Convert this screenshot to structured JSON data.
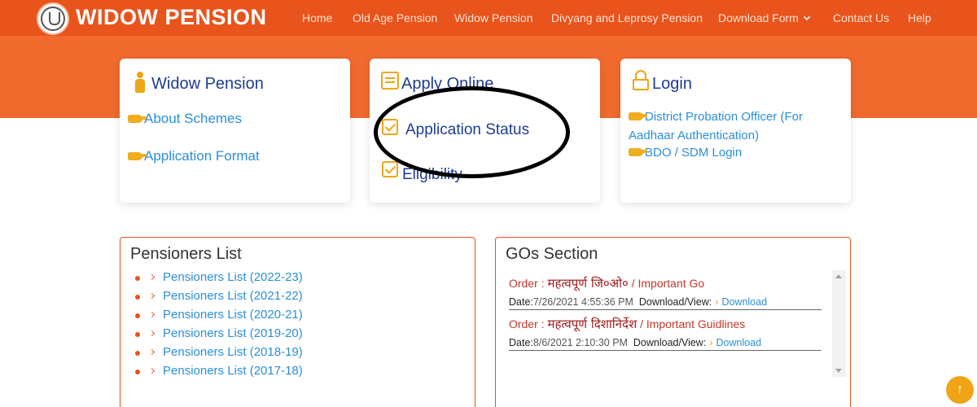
{
  "header": {
    "brand": "WIDOW PENSION",
    "nav": [
      {
        "label": "Home"
      },
      {
        "label": "Old Age Pension"
      },
      {
        "label": "Widow Pension"
      },
      {
        "label": "Divyang and Leprosy Pension"
      },
      {
        "label": "Download Form"
      },
      {
        "label": "Contact Us"
      },
      {
        "label": "Help"
      }
    ]
  },
  "cards": {
    "widow": {
      "title": "Widow Pension",
      "links": [
        "About Schemes",
        "Application Format"
      ]
    },
    "apply": {
      "title": "Apply Online",
      "links": [
        "Application Status",
        "Eligibility"
      ]
    },
    "login": {
      "title": "Login",
      "links": [
        "District Probation Officer (For",
        "Aadhaar Authentication)",
        "BDO / SDM Login"
      ]
    }
  },
  "pensioners": {
    "title": "Pensioners List",
    "items": [
      "Pensioners List (2022-23)",
      "Pensioners List (2021-22)",
      "Pensioners List (2020-21)",
      "Pensioners List (2019-20)",
      "Pensioners List (2018-19)",
      "Pensioners List (2017-18)"
    ]
  },
  "gos": {
    "title": "GOs Section",
    "entries": [
      {
        "order_label": "Order :",
        "hindi": "महत्वपूर्ण जि०ओ०",
        "english": "/ Important Go",
        "date_label": "Date:",
        "date": "7/26/2021 4:55:36 PM",
        "dl_label": "Download/View:",
        "dl_link": "Download"
      },
      {
        "order_label": "Order :",
        "hindi": "महत्वपूर्ण दिशानिर्देश",
        "english": "/ Important Guidlines",
        "date_label": "Date:",
        "date": "8/6/2021 2:10:30 PM",
        "dl_label": "Download/View:",
        "dl_link": "Download"
      }
    ]
  },
  "colors": {
    "brand_orange": "#e8541c",
    "accent_gold": "#f0a516",
    "link_blue": "#2a8fd6",
    "title_navy": "#1e3d8f"
  },
  "icons": {
    "back_to_top": "↑"
  }
}
